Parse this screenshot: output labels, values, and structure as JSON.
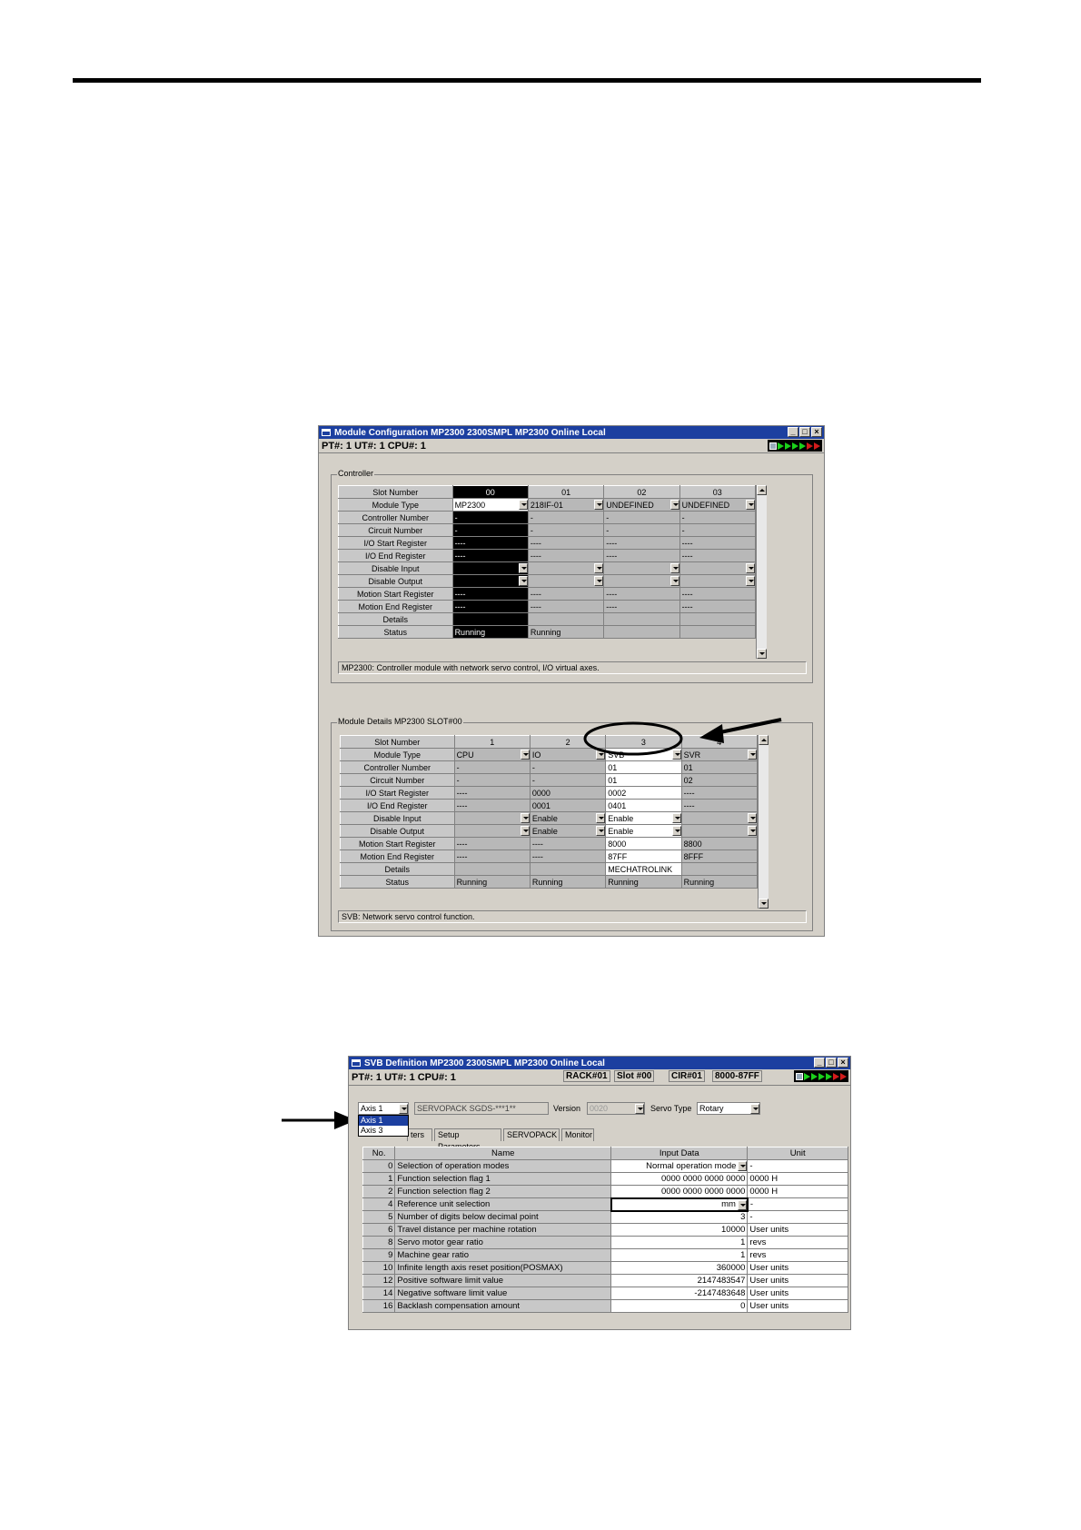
{
  "module_config": {
    "title": "Module Configuration   MP2300  2300SMPL  MP2300   Online  Local",
    "info": "PT#: 1 UT#: 1 CPU#: 1",
    "controller_group_label": "Controller",
    "controller_table": {
      "row_labels": [
        "Slot Number",
        "Module Type",
        "Controller Number",
        "Circuit Number",
        "I/O Start Register",
        "I/O End Register",
        "Disable Input",
        "Disable Output",
        "Motion Start Register",
        "Motion End Register",
        "Details",
        "Status"
      ],
      "slots": [
        "00",
        "01",
        "02",
        "03"
      ],
      "cells": [
        [
          "MP2300",
          "-",
          "-",
          "----",
          "----",
          "",
          "",
          "----",
          "----",
          "",
          "Running"
        ],
        [
          "218IF-01",
          "-",
          "-",
          "----",
          "----",
          "",
          "",
          "----",
          "----",
          "",
          "Running"
        ],
        [
          "UNDEFINED",
          "-",
          "-",
          "----",
          "----",
          "",
          "",
          "----",
          "----",
          "",
          ""
        ],
        [
          "UNDEFINED",
          "-",
          "-",
          "----",
          "----",
          "",
          "",
          "----",
          "----",
          "",
          ""
        ]
      ]
    },
    "controller_desc": "MP2300: Controller module with network servo control, I/O virtual axes.",
    "details_group_label": "Module Details  MP2300  SLOT#00",
    "details_table": {
      "slots": [
        "1",
        "2",
        "3",
        "4"
      ],
      "cells": [
        [
          "CPU",
          "-",
          "-",
          "----",
          "----",
          "",
          "",
          "----",
          "----",
          "",
          "Running"
        ],
        [
          "IO",
          "-",
          "-",
          "0000",
          "0001",
          "Enable",
          "Enable",
          "----",
          "----",
          "",
          "Running"
        ],
        [
          "SVB",
          "01",
          "01",
          "0002",
          "0401",
          "Enable",
          "Enable",
          "8000",
          "87FF",
          "MECHATROLINK",
          "Running"
        ],
        [
          "SVR",
          "01",
          "02",
          "----",
          "----",
          "",
          "",
          "8800",
          "8FFF",
          "",
          "Running"
        ]
      ]
    },
    "details_desc": "SVB: Network servo control function."
  },
  "svb_def": {
    "title": "SVB Definition   MP2300  2300SMPL  MP2300   Online  Local",
    "info": "PT#: 1 UT#: 1 CPU#: 1",
    "rack": "RACK#01",
    "slot": "Slot #00",
    "cir": "CIR#01",
    "range": "8000-87FF",
    "axis_value": "Axis 1",
    "axis_options": [
      "Axis 1",
      "Axis 3"
    ],
    "servopack_value": "SERVOPACK  SGDS-***1**",
    "version_label": "Version",
    "version_value": "0020",
    "servo_type_label": "Servo Type",
    "servo_type_value": "Rotary",
    "tabs": [
      "ters",
      "Setup Parameters",
      "SERVOPACK",
      "Monitor"
    ],
    "headers": [
      "No.",
      "Name",
      "Input Data",
      "Unit"
    ],
    "rows": [
      {
        "no": "0",
        "name": "Selection of operation modes",
        "data": "Normal operation mode",
        "unit": "-"
      },
      {
        "no": "1",
        "name": "Function selection flag 1",
        "data": "0000 0000 0000 0000",
        "unit": "0000 H"
      },
      {
        "no": "2",
        "name": "Function selection flag 2",
        "data": "0000 0000 0000 0000",
        "unit": "0000 H"
      },
      {
        "no": "4",
        "name": "Reference unit selection",
        "data": "mm",
        "unit": "-"
      },
      {
        "no": "5",
        "name": "Number of digits below decimal point",
        "data": "3",
        "unit": "-"
      },
      {
        "no": "6",
        "name": "Travel distance per machine rotation",
        "data": "10000",
        "unit": "User units"
      },
      {
        "no": "8",
        "name": "Servo motor gear ratio",
        "data": "1",
        "unit": "revs"
      },
      {
        "no": "9",
        "name": "Machine gear ratio",
        "data": "1",
        "unit": "revs"
      },
      {
        "no": "10",
        "name": "Infinite length axis reset position(POSMAX)",
        "data": "360000",
        "unit": "User units"
      },
      {
        "no": "12",
        "name": "Positive software limit value",
        "data": "2147483547",
        "unit": "User units"
      },
      {
        "no": "14",
        "name": "Negative software limit value",
        "data": "-2147483648",
        "unit": "User units"
      },
      {
        "no": "16",
        "name": "Backlash compensation amount",
        "data": "0",
        "unit": "User units"
      }
    ]
  }
}
